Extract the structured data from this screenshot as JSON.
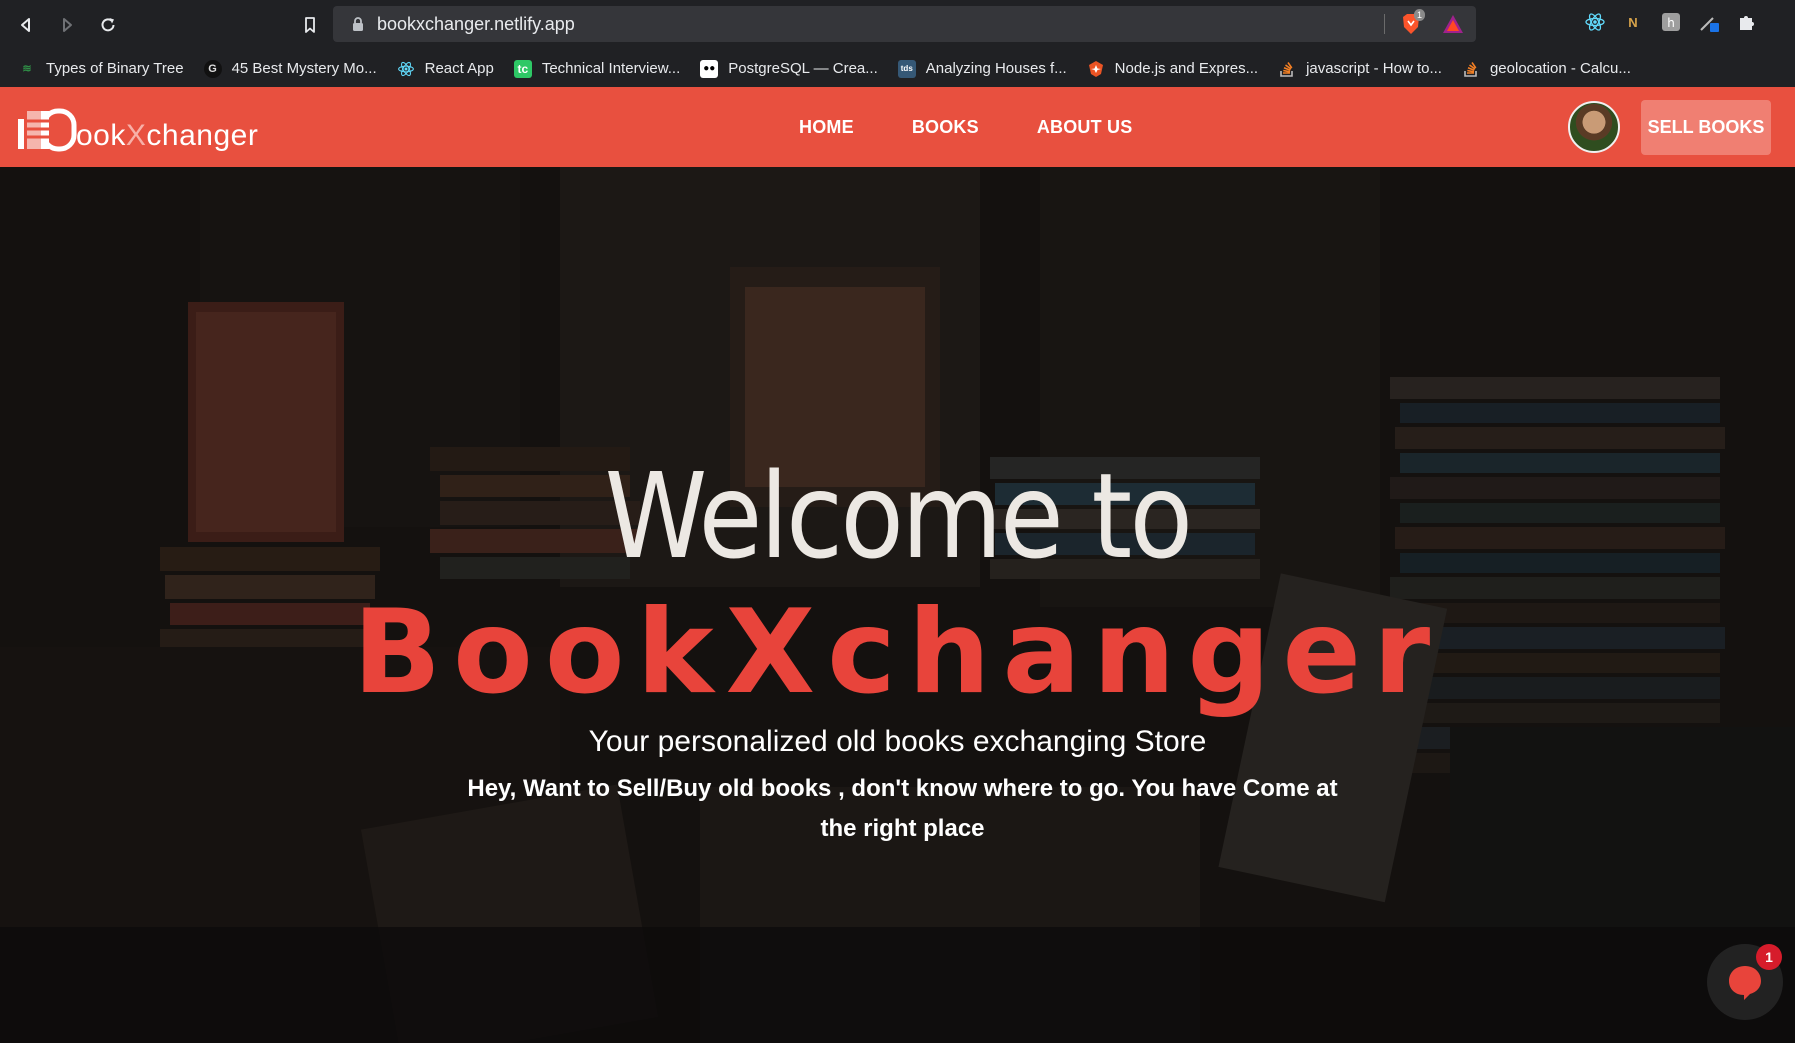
{
  "browser": {
    "url": "bookxchanger.netlify.app",
    "brave_shield_count": "1",
    "bookmarks": [
      {
        "label": "Types of Binary Tree",
        "icon": "gfg-icon",
        "color": "#2f8d46"
      },
      {
        "label": "45 Best Mystery Mo...",
        "icon": "g-icon",
        "color": "#1e1e1e"
      },
      {
        "label": "React App",
        "icon": "react-icon",
        "color": "#61dafb"
      },
      {
        "label": "Technical Interview...",
        "icon": "tc-icon",
        "color": "#2ec866"
      },
      {
        "label": "PostgreSQL — Crea...",
        "icon": "medium-icon",
        "color": "#ffffff"
      },
      {
        "label": "Analyzing Houses f...",
        "icon": "tds-icon",
        "color": "#355876"
      },
      {
        "label": "Node.js and Expres...",
        "icon": "auth0-icon",
        "color": "#eb5424"
      },
      {
        "label": "javascript - How to...",
        "icon": "stackoverflow-icon",
        "color": "#f48024"
      },
      {
        "label": "geolocation - Calcu...",
        "icon": "stackoverflow-icon",
        "color": "#f48024"
      }
    ]
  },
  "site": {
    "logo": {
      "prefix": "ook",
      "x": "X",
      "suffix": "changer"
    },
    "nav": [
      "HOME",
      "BOOKS",
      "ABOUT US"
    ],
    "sell_button": "SELL BOOKS",
    "accent_color": "#e8503f"
  },
  "hero": {
    "welcome": "Welcome to",
    "brand": "BookXchanger",
    "tagline": "Your personalized old books exchanging Store",
    "subtitle": "Hey, Want to Sell/Buy old books , don't know where to go. You have Come at the right place"
  },
  "chat": {
    "badge_count": "1"
  }
}
